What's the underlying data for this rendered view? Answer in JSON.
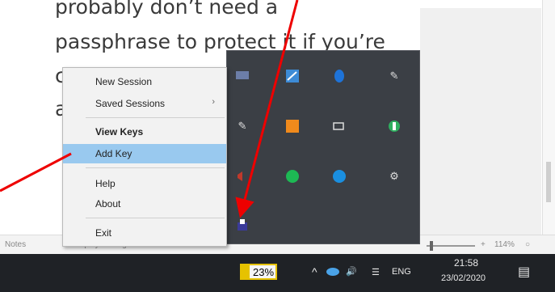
{
  "document": {
    "lines": [
      "probably don’t need a",
      "passphrase to protect it if you’re",
      "c",
      "a"
    ]
  },
  "statusbar": {
    "notes_label": "Notes",
    "display_settings_label": "Display Settings",
    "zoom_level": "114%"
  },
  "context_menu": {
    "new_session": "New Session",
    "saved_sessions": "Saved Sessions",
    "saved_sessions_arrow": "›",
    "view_keys": "View Keys",
    "add_key": "Add Key",
    "help": "Help",
    "about": "About",
    "exit": "Exit"
  },
  "taskbar": {
    "battery_percent": "23%",
    "battery_level": 0.23,
    "language": "ENG",
    "time": "21:58",
    "date": "23/02/2020"
  },
  "annotations": {
    "arrow_color": "#ee0000"
  }
}
